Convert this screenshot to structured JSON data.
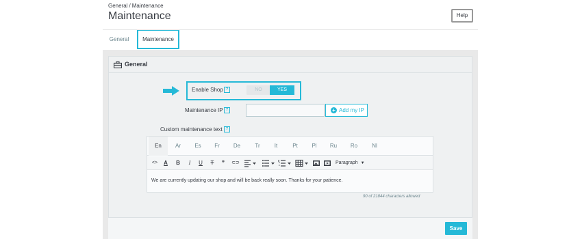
{
  "breadcrumb": {
    "items": [
      "General",
      "Maintenance"
    ],
    "separator": "/"
  },
  "page": {
    "title": "Maintenance",
    "help_label": "Help"
  },
  "tabs": [
    {
      "label": "General",
      "active": false
    },
    {
      "label": "Maintenance",
      "active": true
    }
  ],
  "panel": {
    "title": "General",
    "enable_shop": {
      "label": "Enable Shop",
      "help": "?",
      "options": [
        "NO",
        "YES"
      ],
      "selected": "YES"
    },
    "maintenance_ip": {
      "label": "Maintenance IP",
      "help": "?",
      "value": "",
      "add_button_label": "Add my IP",
      "add_icon": "+"
    },
    "custom_text": {
      "label": "Custom maintenance text",
      "help": "?",
      "languages": [
        "En",
        "Ar",
        "Es",
        "Fr",
        "De",
        "Tr",
        "It",
        "Pt",
        "Pl",
        "Ru",
        "Ro",
        "Nl"
      ],
      "active_language": "En",
      "toolbar": {
        "icons": [
          "source-code-icon",
          "text-color-icon",
          "italic-icon",
          "bold-icon",
          "underline-icon",
          "strikethrough-icon",
          "blockquote-icon",
          "link-icon",
          "align-icon",
          "bullet-list-icon",
          "numbered-list-icon",
          "table-icon",
          "image-icon",
          "media-icon"
        ],
        "glyphs": {
          "source": "<>",
          "color": "A",
          "italic": "I",
          "bold": "B",
          "underline": "U",
          "strike": "T",
          "quote": "❞",
          "link": "⊂⊃"
        },
        "format_label": "Paragraph"
      },
      "content": "We are currently updating our shop and will be back really soon. Thanks for your patience.",
      "counter": "90 of 21844 characters allowed"
    },
    "save_label": "Save"
  },
  "colors": {
    "accent": "#25b9d7",
    "text": "#363a41",
    "panel_bg": "#eff1f2"
  }
}
